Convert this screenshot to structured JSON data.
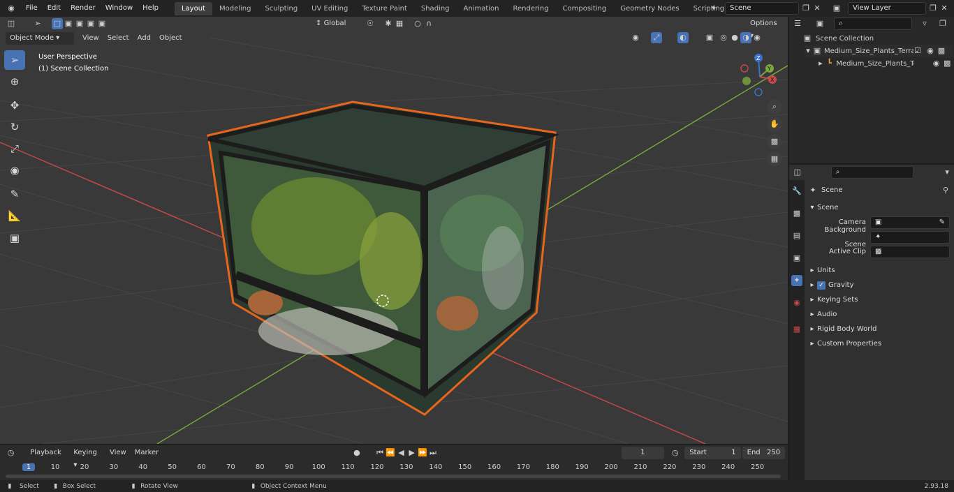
{
  "topbar": {
    "menus": [
      "File",
      "Edit",
      "Render",
      "Window",
      "Help"
    ],
    "workspaces": [
      "Layout",
      "Modeling",
      "Sculpting",
      "UV Editing",
      "Texture Paint",
      "Shading",
      "Animation",
      "Rendering",
      "Compositing",
      "Geometry Nodes",
      "Scripting"
    ],
    "active_workspace": "Layout",
    "add_tab": "+",
    "scene_name": "Scene",
    "view_layer": "View Layer"
  },
  "viewport": {
    "mode": "Object Mode",
    "menus": [
      "View",
      "Select",
      "Add",
      "Object"
    ],
    "orientation": "Global",
    "options_label": "Options",
    "overlay_line1": "User Perspective",
    "overlay_line2": "(1) Scene Collection",
    "gizmo_z": "Z",
    "gizmo_y": "Y",
    "gizmo_x": "X"
  },
  "outliner": {
    "root": "Scene Collection",
    "collection": "Medium_Size_Plants_Terrariur",
    "object": "Medium_Size_Plants_Terr"
  },
  "properties": {
    "header": "Scene",
    "section": "Scene",
    "camera_label": "Camera",
    "background_label": "Background Scene",
    "clip_label": "Active Clip",
    "panels": [
      "Units",
      "Gravity",
      "Keying Sets",
      "Audio",
      "Rigid Body World",
      "Custom Properties"
    ]
  },
  "timeline": {
    "menus": [
      "Playback",
      "Keying",
      "View",
      "Marker"
    ],
    "current_frame": "1",
    "start_label": "Start",
    "start_value": "1",
    "end_label": "End",
    "end_value": "250",
    "ruler": [
      "1",
      "10",
      "20",
      "30",
      "40",
      "50",
      "60",
      "70",
      "80",
      "90",
      "100",
      "110",
      "120",
      "130",
      "140",
      "150",
      "160",
      "170",
      "180",
      "190",
      "200",
      "210",
      "220",
      "230",
      "240",
      "250"
    ]
  },
  "statusbar": {
    "select": "Select",
    "box_select": "Box Select",
    "rotate": "Rotate View",
    "context": "Object Context Menu",
    "version": "2.93.18"
  },
  "colors": {
    "accent": "#4772b3",
    "selection_outline": "#e8651c",
    "grid_x": "#c9494a",
    "grid_y": "#7aa83e"
  }
}
